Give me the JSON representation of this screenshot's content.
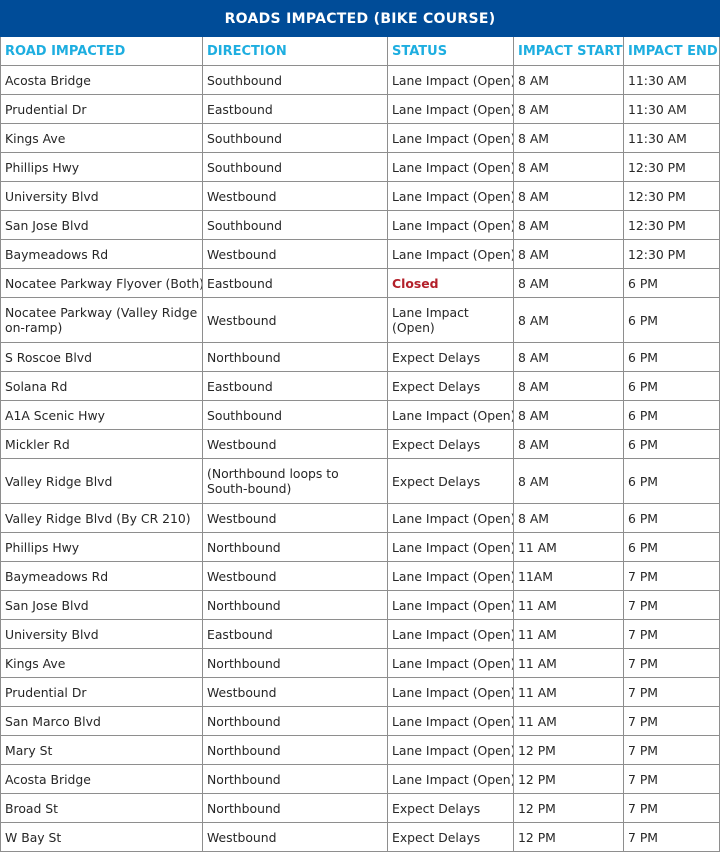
{
  "title": "ROADS IMPACTED (BIKE COURSE)",
  "headers": [
    "ROAD IMPACTED",
    "DIRECTION",
    "STATUS",
    "IMPACT START",
    "IMPACT END"
  ],
  "colors": {
    "banner": "#004c98",
    "header_text": "#1eaee0",
    "closed_text": "#b3202a"
  },
  "rows": [
    [
      "Acosta Bridge",
      "Southbound",
      "Lane Impact (Open)",
      "8 AM",
      "11:30 AM"
    ],
    [
      "Prudential Dr",
      "Eastbound",
      "Lane Impact (Open)",
      "8 AM",
      "11:30 AM"
    ],
    [
      "Kings Ave",
      "Southbound",
      "Lane Impact (Open)",
      "8 AM",
      "11:30 AM"
    ],
    [
      "Phillips Hwy",
      "Southbound",
      "Lane Impact (Open)",
      "8 AM",
      "12:30 PM"
    ],
    [
      "University Blvd",
      "Westbound",
      "Lane Impact (Open)",
      "8 AM",
      "12:30 PM"
    ],
    [
      "San Jose Blvd",
      "Southbound",
      "Lane Impact (Open)",
      "8 AM",
      "12:30 PM"
    ],
    [
      "Baymeadows Rd",
      "Westbound",
      "Lane Impact (Open)",
      "8 AM",
      "12:30 PM"
    ],
    [
      "Nocatee Parkway Flyover (Both)",
      "Eastbound",
      "Closed",
      "8 AM",
      "6 PM"
    ],
    [
      "Nocatee Parkway (Valley Ridge on-ramp)",
      "Westbound",
      "Lane Impact (Open)",
      "8 AM",
      "6 PM"
    ],
    [
      "S Roscoe Blvd",
      "Northbound",
      "Expect Delays",
      "8 AM",
      "6 PM"
    ],
    [
      "Solana Rd",
      "Eastbound",
      "Expect Delays",
      "8 AM",
      "6 PM"
    ],
    [
      "A1A Scenic Hwy",
      "Southbound",
      "Lane Impact (Open)",
      "8 AM",
      "6 PM"
    ],
    [
      "Mickler Rd",
      "Westbound",
      "Expect Delays",
      "8 AM",
      "6 PM"
    ],
    [
      "Valley Ridge Blvd",
      "(Northbound loops to South-bound)",
      "Expect Delays",
      "8 AM",
      "6 PM"
    ],
    [
      "Valley Ridge Blvd (By CR 210)",
      "Westbound",
      "Lane Impact (Open)",
      "8 AM",
      "6 PM"
    ],
    [
      "Phillips Hwy",
      "Northbound",
      "Lane Impact (Open)",
      "11 AM",
      "6 PM"
    ],
    [
      "Baymeadows Rd",
      "Westbound",
      "Lane Impact (Open)",
      "11AM",
      "7 PM"
    ],
    [
      "San Jose Blvd",
      "Northbound",
      "Lane Impact (Open)",
      "11 AM",
      "7 PM"
    ],
    [
      "University Blvd",
      "Eastbound",
      "Lane Impact (Open)",
      "11 AM",
      "7 PM"
    ],
    [
      "Kings Ave",
      "Northbound",
      "Lane Impact (Open)",
      "11 AM",
      "7 PM"
    ],
    [
      "Prudential Dr",
      "Westbound",
      "Lane Impact (Open)",
      "11 AM",
      "7 PM"
    ],
    [
      "San Marco Blvd",
      "Northbound",
      "Lane Impact (Open)",
      "11 AM",
      "7 PM"
    ],
    [
      "Mary St",
      "Northbound",
      "Lane Impact (Open)",
      "12 PM",
      "7 PM"
    ],
    [
      "Acosta Bridge",
      "Northbound",
      "Lane Impact (Open)",
      "12 PM",
      "7 PM"
    ],
    [
      "Broad St",
      "Northbound",
      "Expect Delays",
      "12 PM",
      "7 PM"
    ],
    [
      "W Bay St",
      "Westbound",
      "Expect Delays",
      "12 PM",
      "7 PM"
    ]
  ]
}
